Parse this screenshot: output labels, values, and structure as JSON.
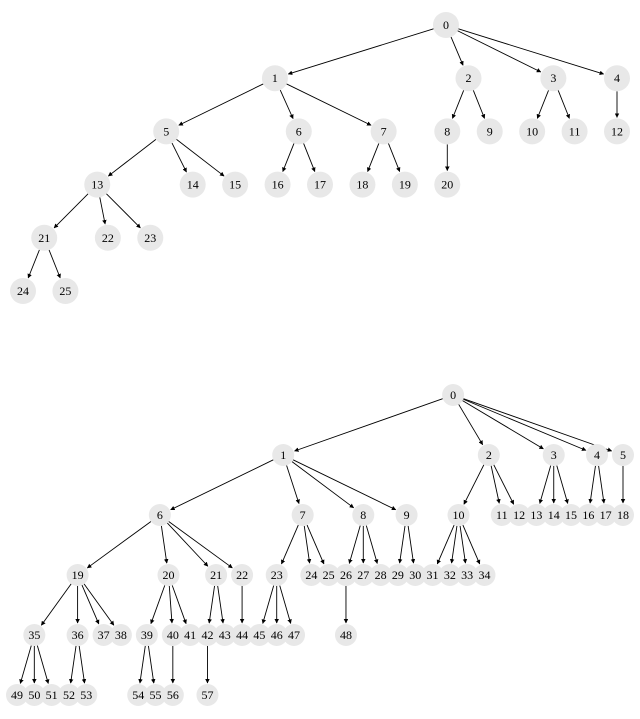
{
  "chart_data": [
    {
      "type": "tree",
      "root": 0,
      "edges": [
        [
          0,
          1
        ],
        [
          0,
          2
        ],
        [
          0,
          3
        ],
        [
          0,
          4
        ],
        [
          1,
          5
        ],
        [
          1,
          6
        ],
        [
          1,
          7
        ],
        [
          2,
          8
        ],
        [
          2,
          9
        ],
        [
          3,
          10
        ],
        [
          3,
          11
        ],
        [
          4,
          12
        ],
        [
          5,
          13
        ],
        [
          5,
          14
        ],
        [
          5,
          15
        ],
        [
          6,
          16
        ],
        [
          6,
          17
        ],
        [
          7,
          18
        ],
        [
          7,
          19
        ],
        [
          8,
          20
        ],
        [
          13,
          21
        ],
        [
          13,
          22
        ],
        [
          13,
          23
        ],
        [
          21,
          24
        ],
        [
          21,
          25
        ]
      ],
      "nodes": [
        "0",
        "1",
        "2",
        "3",
        "4",
        "5",
        "6",
        "7",
        "8",
        "9",
        "10",
        "11",
        "12",
        "13",
        "14",
        "15",
        "16",
        "17",
        "18",
        "19",
        "20",
        "21",
        "22",
        "23",
        "24",
        "25"
      ]
    },
    {
      "type": "tree",
      "root": 0,
      "edges": [
        [
          0,
          1
        ],
        [
          0,
          2
        ],
        [
          0,
          3
        ],
        [
          0,
          4
        ],
        [
          0,
          5
        ],
        [
          1,
          6
        ],
        [
          1,
          7
        ],
        [
          1,
          8
        ],
        [
          1,
          9
        ],
        [
          2,
          10
        ],
        [
          2,
          11
        ],
        [
          2,
          12
        ],
        [
          3,
          13
        ],
        [
          3,
          14
        ],
        [
          3,
          15
        ],
        [
          4,
          16
        ],
        [
          4,
          17
        ],
        [
          5,
          18
        ],
        [
          6,
          19
        ],
        [
          6,
          20
        ],
        [
          6,
          21
        ],
        [
          6,
          22
        ],
        [
          7,
          23
        ],
        [
          7,
          24
        ],
        [
          7,
          25
        ],
        [
          8,
          26
        ],
        [
          8,
          27
        ],
        [
          8,
          28
        ],
        [
          9,
          29
        ],
        [
          9,
          30
        ],
        [
          10,
          31
        ],
        [
          10,
          32
        ],
        [
          10,
          33
        ],
        [
          10,
          34
        ],
        [
          19,
          35
        ],
        [
          19,
          36
        ],
        [
          19,
          37
        ],
        [
          19,
          38
        ],
        [
          20,
          39
        ],
        [
          20,
          40
        ],
        [
          20,
          41
        ],
        [
          21,
          42
        ],
        [
          21,
          43
        ],
        [
          22,
          44
        ],
        [
          23,
          45
        ],
        [
          23,
          46
        ],
        [
          23,
          47
        ],
        [
          26,
          48
        ],
        [
          35,
          49
        ],
        [
          35,
          50
        ],
        [
          35,
          51
        ],
        [
          36,
          52
        ],
        [
          36,
          53
        ],
        [
          39,
          54
        ],
        [
          39,
          55
        ],
        [
          40,
          56
        ],
        [
          42,
          57
        ]
      ],
      "nodes": [
        "0",
        "1",
        "2",
        "3",
        "4",
        "5",
        "6",
        "7",
        "8",
        "9",
        "10",
        "11",
        "12",
        "13",
        "14",
        "15",
        "16",
        "17",
        "18",
        "19",
        "20",
        "21",
        "22",
        "23",
        "24",
        "25",
        "26",
        "27",
        "28",
        "29",
        "30",
        "31",
        "32",
        "33",
        "34",
        "35",
        "36",
        "37",
        "38",
        "39",
        "40",
        "41",
        "42",
        "43",
        "44",
        "45",
        "46",
        "47",
        "48",
        "49",
        "50",
        "51",
        "52",
        "53",
        "54",
        "55",
        "56",
        "57"
      ]
    }
  ]
}
